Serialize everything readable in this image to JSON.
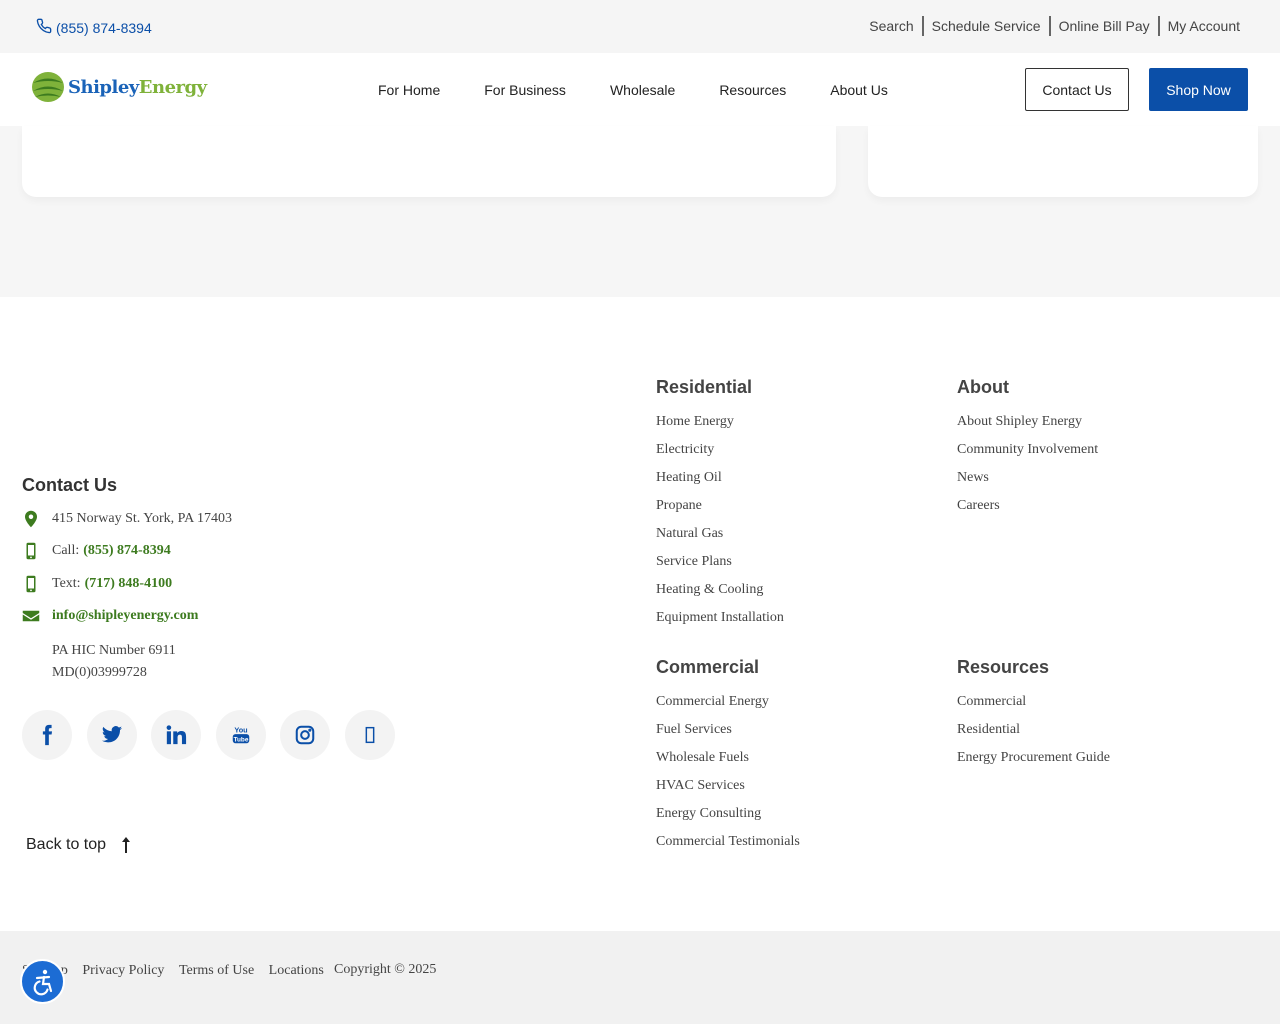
{
  "utility": {
    "phone": "(855) 874-8394",
    "links": [
      "Search",
      "Schedule Service",
      "Online Bill Pay",
      "My Account"
    ]
  },
  "header": {
    "logo_shipley": "Shipley",
    "logo_energy": "Energy",
    "nav": [
      "For Home",
      "For Business",
      "Wholesale",
      "Resources",
      "About Us"
    ],
    "contact_label": "Contact Us",
    "shop_label": "Shop Now"
  },
  "footer": {
    "contact": {
      "heading": "Contact Us",
      "address": "415 Norway St. York, PA 17403",
      "call_label": "Call:",
      "call_number": "(855) 874-8394",
      "text_label": "Text:",
      "text_number": "(717) 848-4100",
      "email": "info@shipleyenergy.com",
      "hic_1": "PA HIC Number 6911",
      "hic_2": "MD(0)03999728"
    },
    "social": [
      "facebook-icon",
      "twitter-icon",
      "linkedin-icon",
      "youtube-icon",
      "instagram-icon",
      "generic-social-icon"
    ],
    "back_to_top": "Back to top",
    "residential": {
      "heading": "Residential",
      "items": [
        "Home Energy",
        "Electricity",
        "Heating Oil",
        "Propane",
        "Natural Gas",
        "Service Plans",
        "Heating & Cooling",
        "Equipment Installation"
      ]
    },
    "about": {
      "heading": "About",
      "items": [
        "About Shipley Energy",
        "Community Involvement",
        "News",
        "Careers"
      ]
    },
    "commercial": {
      "heading": "Commercial",
      "items": [
        "Commercial Energy",
        "Fuel Services",
        "Wholesale Fuels",
        "HVAC Services",
        "Energy Consulting",
        "Commercial Testimonials"
      ]
    },
    "resources": {
      "heading": "Resources",
      "items": [
        "Commercial",
        "Residential",
        "Energy Procurement Guide"
      ]
    }
  },
  "bottom": {
    "links": [
      "Sitemap",
      "Privacy Policy",
      "Terms of Use",
      "Locations"
    ],
    "copyright": "Copyright © 2025"
  },
  "colors": {
    "brand_blue": "#0b4fa8",
    "brand_green": "#3d7b1f",
    "logo_green": "#7fb23a"
  }
}
